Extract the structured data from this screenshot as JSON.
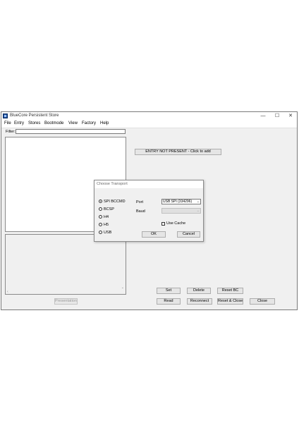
{
  "window": {
    "title": "BlueCore Persistent Store",
    "controls": {
      "minimize": "—",
      "maximize": "☐",
      "close": "✕"
    }
  },
  "menu": [
    "File",
    "Entry",
    "Stores",
    "Bootmode",
    "View",
    "Factory",
    "Help"
  ],
  "filter": {
    "label": "Filter:",
    "value": ""
  },
  "entry_button": "ENTRY NOT PRESENT - Click to add",
  "buttons": {
    "set": "Set",
    "delete": "Delete",
    "reset_bc": "Reset BC",
    "read": "Read",
    "reconnect": "Reconnect",
    "reset_close": "Reset & Close",
    "close": "Close",
    "presentation": "Presentation"
  },
  "dialog": {
    "title": "Choose Transport",
    "transports": [
      {
        "label": "SPI BCCMD",
        "checked": true
      },
      {
        "label": "BCSP",
        "checked": false
      },
      {
        "label": "H4",
        "checked": false
      },
      {
        "label": "H5",
        "checked": false
      },
      {
        "label": "USB",
        "checked": false
      }
    ],
    "port_label": "Port",
    "port_value": "USB SPI (334296)",
    "baud_label": "Baud",
    "baud_value": "",
    "use_cache_label": "Use Cache",
    "use_cache_checked": false,
    "ok": "OK",
    "cancel": "Cancel"
  }
}
